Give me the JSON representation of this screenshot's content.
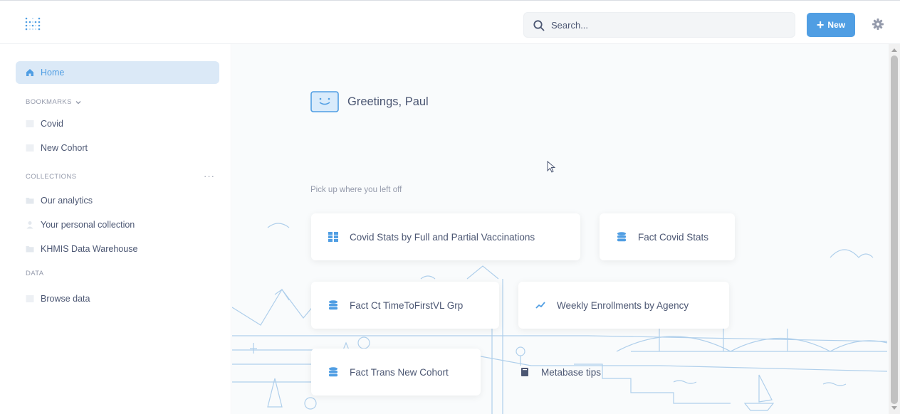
{
  "topbar": {
    "logo_icon": "metabase-logo-icon",
    "search": {
      "placeholder": "Search...",
      "icon": "search-icon"
    },
    "new_button": {
      "label": "New",
      "icon": "plus-icon"
    },
    "settings_icon": "gear-icon"
  },
  "sidebar": {
    "home": {
      "label": "Home",
      "icon": "home-icon"
    },
    "bookmarks_header": "BOOKMARKS",
    "bookmarks": [
      {
        "label": "Covid",
        "icon": "table-icon"
      },
      {
        "label": "New Cohort",
        "icon": "table-icon"
      }
    ],
    "collections_header": "COLLECTIONS",
    "collections_menu": "···",
    "collections": [
      {
        "label": "Our analytics",
        "icon": "folder-icon"
      },
      {
        "label": "Your personal collection",
        "icon": "person-icon"
      },
      {
        "label": "KHMIS Data Warehouse",
        "icon": "folder-icon"
      }
    ],
    "data_header": "DATA",
    "data": [
      {
        "label": "Browse data",
        "icon": "database-icon"
      }
    ]
  },
  "main": {
    "greeting": "Greetings, Paul",
    "pickup_label": "Pick up where you left off",
    "cards": [
      {
        "label": "Covid Stats by Full and Partial Vaccinations",
        "icon": "grid-icon"
      },
      {
        "label": "Fact Covid Stats",
        "icon": "database-icon"
      },
      {
        "label": "Fact Ct TimeToFirstVL Grp",
        "icon": "database-icon"
      },
      {
        "label": "Weekly Enrollments by Agency",
        "icon": "line-chart-icon"
      },
      {
        "label": "Fact Trans New Cohort",
        "icon": "database-icon"
      },
      {
        "label": "Metabase tips",
        "icon": "book-icon"
      }
    ]
  },
  "colors": {
    "brand": "#509ee3",
    "text": "#4c5773",
    "muted": "#949aab",
    "active_bg": "#dbe9f7"
  }
}
